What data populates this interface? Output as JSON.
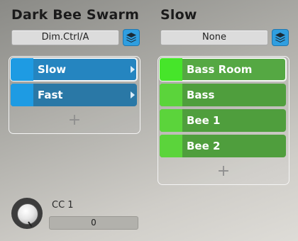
{
  "left": {
    "title": "Dark Bee Swarm",
    "selector_value": "Dim.Ctrl/A",
    "items": [
      {
        "label": "Slow",
        "selected": true
      },
      {
        "label": "Fast",
        "selected": false
      }
    ],
    "add_symbol": "+",
    "knob": {
      "label": "CC 1",
      "value": "0"
    }
  },
  "right": {
    "title": "Slow",
    "selector_value": "None",
    "items": [
      {
        "label": "Bass Room",
        "selected": true
      },
      {
        "label": "Bass",
        "selected": false
      },
      {
        "label": "Bee 1",
        "selected": false
      },
      {
        "label": "Bee 2",
        "selected": false
      }
    ],
    "add_symbol": "+"
  },
  "colors": {
    "blue_row": "#2a78a6",
    "blue_swatch": "#1e9be3",
    "green_row": "#4f9e3d",
    "green_swatch": "#5bd43b"
  },
  "icons": {
    "layers_button": "layers-icon",
    "row_arrow": "chevron-right-icon",
    "add": "plus-icon"
  }
}
